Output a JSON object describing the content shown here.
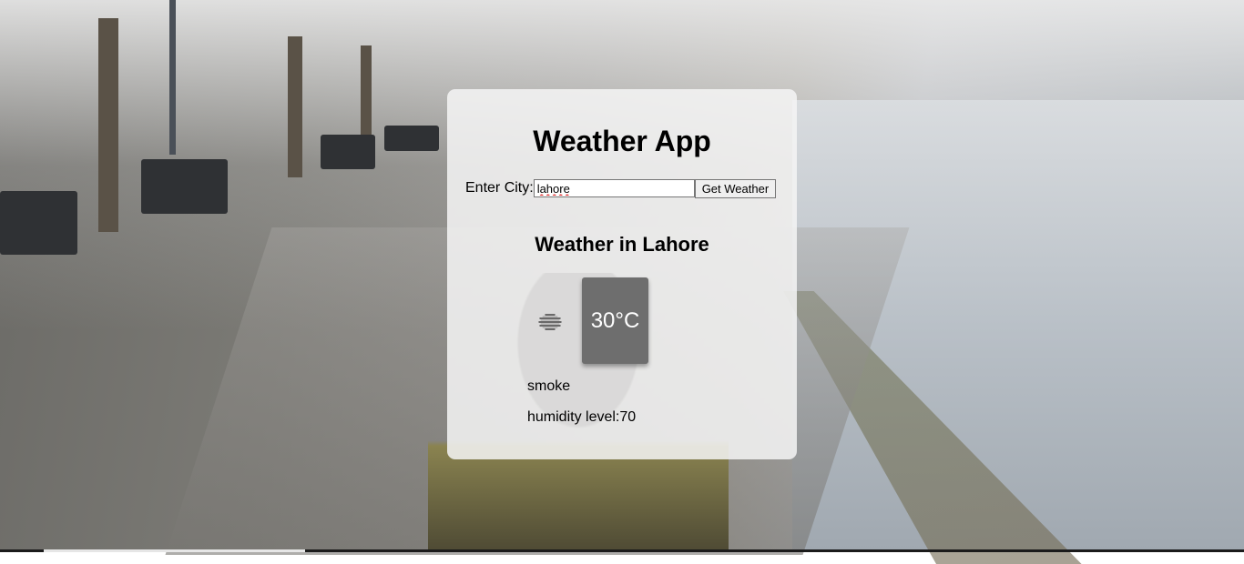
{
  "app": {
    "title": "Weather App"
  },
  "search": {
    "label": "Enter City:",
    "value": "lahore",
    "button_label": "Get Weather"
  },
  "weather": {
    "heading": "Weather in Lahore",
    "icon": "haze-icon",
    "temperature": "30°C",
    "description": "smoke",
    "humidity": "humidity level:70"
  },
  "colors": {
    "card_background": "#f5f5f5",
    "temperature_box": "#6e6e6e",
    "temperature_text": "#ffffff"
  }
}
